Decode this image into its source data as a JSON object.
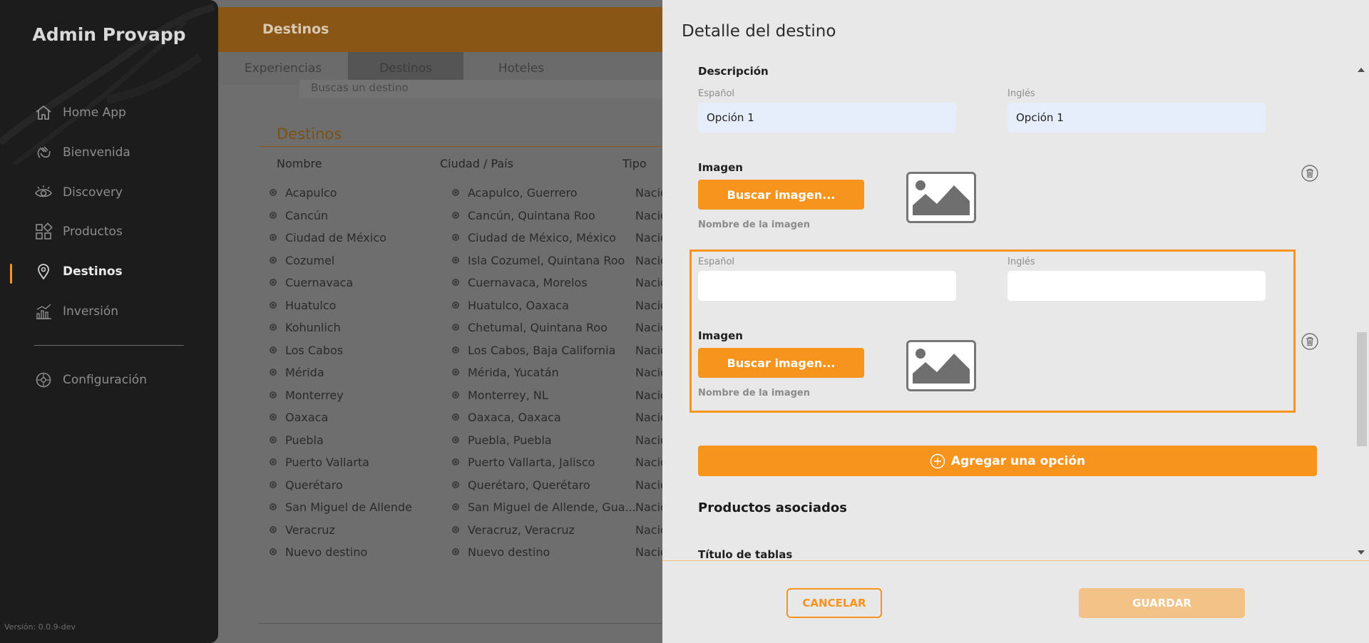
{
  "sidebar": {
    "brand": "Admin Provapp",
    "items": [
      {
        "label": "Home App",
        "icon": "home-icon"
      },
      {
        "label": "Bienvenida",
        "icon": "wave-hand-icon"
      },
      {
        "label": "Discovery",
        "icon": "eye-icon"
      },
      {
        "label": "Productos",
        "icon": "grid-icon"
      },
      {
        "label": "Destinos",
        "icon": "location-pin-icon",
        "active": true
      },
      {
        "label": "Inversión",
        "icon": "bar-chart-icon"
      }
    ],
    "config": {
      "label": "Configuración",
      "icon": "settings-wheel-icon"
    },
    "version": "Versión: 0.0.9-dev"
  },
  "background": {
    "header_title": "Destinos",
    "tabs": [
      "Experiencias",
      "Destinos",
      "Hoteles"
    ],
    "search_placeholder": "Buscas un destino",
    "section_title": "Destinos",
    "columns": [
      "Nombre",
      "Ciudad / País",
      "Tipo"
    ],
    "rows": [
      {
        "name": "Acapulco",
        "city": "Acapulco, Guerrero",
        "type": "Nacio"
      },
      {
        "name": "Cancún",
        "city": "Cancún, Quintana Roo",
        "type": "Nacio"
      },
      {
        "name": "Ciudad de México",
        "city": "Ciudad de México, México",
        "type": "Nacio"
      },
      {
        "name": "Cozumel",
        "city": "Isla Cozumel, Quintana Roo",
        "type": "Nacio"
      },
      {
        "name": "Cuernavaca",
        "city": "Cuernavaca, Morelos",
        "type": "Nacio"
      },
      {
        "name": "Huatulco",
        "city": "Huatulco, Oaxaca",
        "type": "Nacio"
      },
      {
        "name": "Kohunlich",
        "city": "Chetumal, Quintana Roo",
        "type": "Nacio"
      },
      {
        "name": "Los Cabos",
        "city": "Los Cabos, Baja California",
        "type": "Nacio"
      },
      {
        "name": "Mérida",
        "city": "Mérida, Yucatán",
        "type": "Nacio"
      },
      {
        "name": "Monterrey",
        "city": "Monterrey, NL",
        "type": "Nacio"
      },
      {
        "name": "Oaxaca",
        "city": "Oaxaca, Oaxaca",
        "type": "Nacio"
      },
      {
        "name": "Puebla",
        "city": "Puebla, Puebla",
        "type": "Nacio"
      },
      {
        "name": "Puerto Vallarta",
        "city": "Puerto Vallarta, Jalisco",
        "type": "Nacio"
      },
      {
        "name": "Querétaro",
        "city": "Querétaro, Querétaro",
        "type": "Nacio"
      },
      {
        "name": "San Miguel de Allende",
        "city": "San Miguel de Allende, Gua...",
        "type": "Nacio"
      },
      {
        "name": "Veracruz",
        "city": "Veracruz, Veracruz",
        "type": "Nacio"
      },
      {
        "name": "Nuevo destino",
        "city": "Nuevo destino",
        "type": "Nacio"
      }
    ]
  },
  "modal": {
    "title": "Detalle del destino",
    "description_label": "Descripción",
    "option1": {
      "es_label": "Español",
      "en_label": "Inglés",
      "es_value": "Opción 1",
      "en_value": "Opción 1",
      "image_label": "Imagen",
      "search_button": "Buscar imagen...",
      "image_name_label": "Nombre de la imagen"
    },
    "option2": {
      "es_label": "Español",
      "en_label": "Inglés",
      "es_value": "",
      "en_value": "",
      "image_label": "Imagen",
      "search_button": "Buscar imagen...",
      "image_name_label": "Nombre de la imagen"
    },
    "add_option_button": "Agregar una opción",
    "products_title": "Productos asociados",
    "tables_title": "Título de tablas",
    "cancel_button": "CANCELAR",
    "save_button": "GUARDAR"
  },
  "colors": {
    "accent": "#f7941d",
    "sidebar_bg": "#1c1c1c",
    "modal_bg": "#e8e8e8",
    "save_disabled": "#f2c286"
  }
}
